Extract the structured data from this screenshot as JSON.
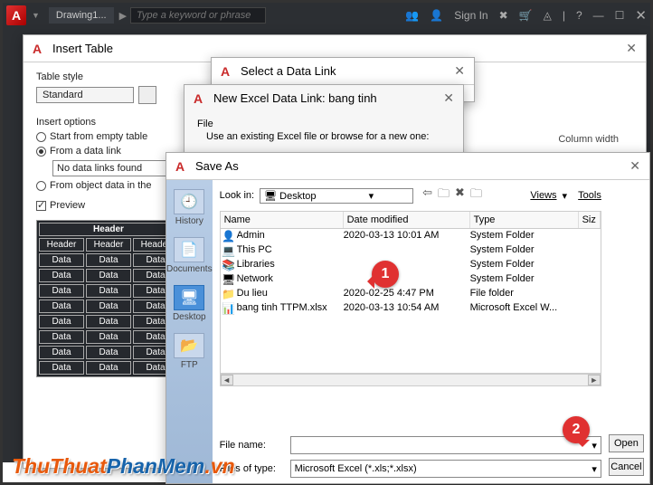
{
  "topbar": {
    "file_tab": "Drawing1...",
    "search_placeholder": "Type a keyword or phrase",
    "signin": "Sign In"
  },
  "insert_table": {
    "title": "Insert Table",
    "style_label": "Table style",
    "style_value": "Standard",
    "opts_label": "Insert options",
    "opt_empty": "Start from empty table",
    "opt_link": "From a data link",
    "link_value": "No data links found",
    "opt_object": "From object data in the",
    "preview_label": "Preview",
    "header": "Header",
    "data": "Data",
    "col_width_label": "Column width"
  },
  "sdl": {
    "title": "Select a Data Link"
  },
  "nedl": {
    "title": "New Excel Data Link: bang tinh",
    "file_label": "File",
    "file_hint": "Use an existing Excel file or browse for a new one:"
  },
  "saveas": {
    "title": "Save As",
    "lookin": "Look in:",
    "lookin_value": "Desktop",
    "views": "Views",
    "tools": "Tools",
    "cols": {
      "name": "Name",
      "date": "Date modified",
      "type": "Type",
      "size": "Siz"
    },
    "rows": [
      {
        "icon": "👤",
        "name": "Admin",
        "date": "2020-03-13 10:01 AM",
        "type": "System Folder"
      },
      {
        "icon": "💻",
        "name": "This PC",
        "date": "",
        "type": "System Folder"
      },
      {
        "icon": "📚",
        "name": "Libraries",
        "date": "",
        "type": "System Folder"
      },
      {
        "icon": "🖥",
        "name": "Network",
        "date": "",
        "type": "System Folder"
      },
      {
        "icon": "📁",
        "name": "Du lieu",
        "date": "2020-02-25 4:47 PM",
        "type": "File folder"
      },
      {
        "icon": "📊",
        "name": "bang tinh TTPM.xlsx",
        "date": "2020-03-13 10:54 AM",
        "type": "Microsoft Excel W..."
      }
    ],
    "places": {
      "history": "History",
      "documents": "Documents",
      "desktop": "Desktop",
      "ftp": "FTP"
    },
    "filename_label": "File name:",
    "filetype_label": "Files of type:",
    "filetype_value": "Microsoft Excel (*.xls;*.xlsx)",
    "open": "Open",
    "cancel": "Cancel"
  },
  "callouts": {
    "c1": "1",
    "c2": "2"
  },
  "watermark": {
    "a": "ThuThuat",
    "b": "PhanMem",
    "c": ".vn"
  }
}
